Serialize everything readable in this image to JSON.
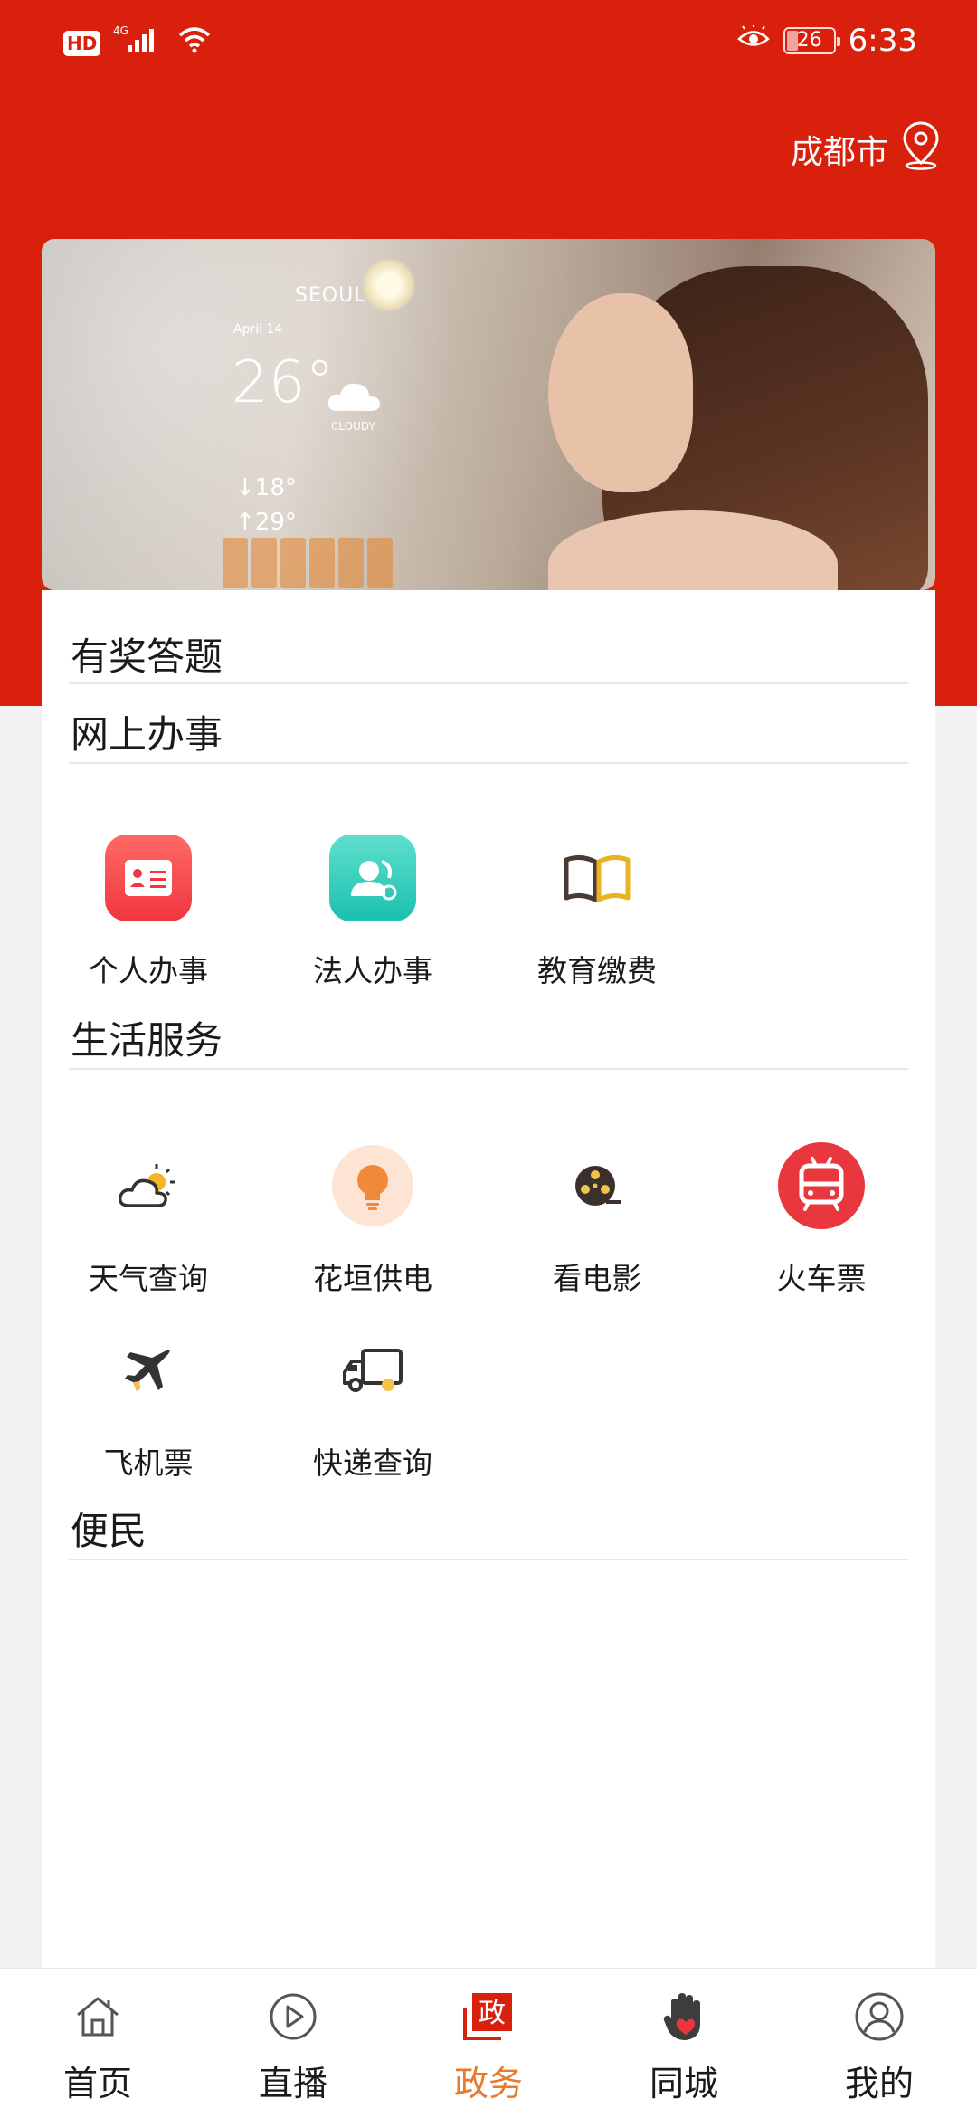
{
  "status_bar": {
    "hd": "HD",
    "network": "4G",
    "battery": "26",
    "time": "6:33"
  },
  "location": {
    "city": "成都市",
    "icon": "location-pin-icon"
  },
  "banner": {
    "city": "SEOUL",
    "date": "April 14",
    "temp": "26°",
    "condition": "CLOUDY",
    "low": "↓18°",
    "high": "↑29°"
  },
  "sections": {
    "quiz": "有奖答题",
    "online": "网上办事",
    "life": "生活服务",
    "convenience": "便民"
  },
  "online_items": [
    {
      "label": "个人办事",
      "icon": "id-card-icon",
      "color": "#f5434b"
    },
    {
      "label": "法人办事",
      "icon": "person-badge-icon",
      "color": "#22c5b4"
    },
    {
      "label": "教育缴费",
      "icon": "book-icon",
      "color": "#e9a321"
    }
  ],
  "life_items": [
    {
      "label": "天气查询",
      "icon": "weather-icon"
    },
    {
      "label": "花垣供电",
      "icon": "lightbulb-icon",
      "color": "#f08a3a"
    },
    {
      "label": "看电影",
      "icon": "film-reel-icon"
    },
    {
      "label": "火车票",
      "icon": "train-icon",
      "color": "#e8373d"
    },
    {
      "label": "飞机票",
      "icon": "airplane-icon"
    },
    {
      "label": "快递查询",
      "icon": "delivery-truck-icon"
    }
  ],
  "nav": [
    {
      "label": "首页",
      "icon": "home-icon"
    },
    {
      "label": "直播",
      "icon": "play-icon"
    },
    {
      "label": "政务",
      "icon": "government-icon",
      "active": true
    },
    {
      "label": "同城",
      "icon": "hand-heart-icon"
    },
    {
      "label": "我的",
      "icon": "profile-icon"
    }
  ],
  "colors": {
    "primary_red": "#d9200c",
    "active_orange": "#e87a2c"
  }
}
